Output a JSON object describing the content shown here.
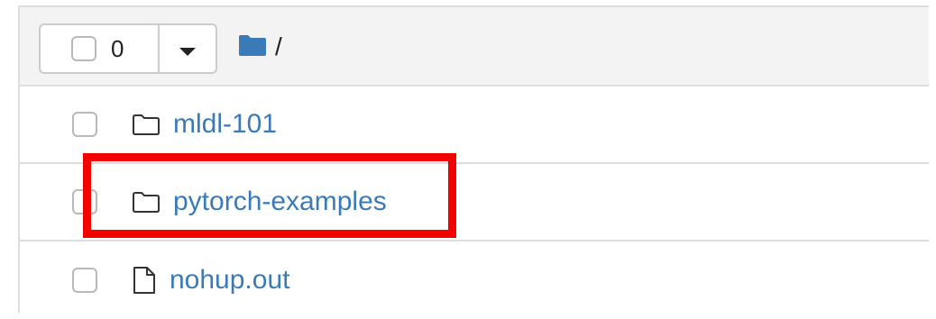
{
  "toolbar": {
    "selected_count": "0",
    "breadcrumb_separator": "/",
    "home_icon": "folder-icon",
    "dropdown_icon": "caret-down-icon"
  },
  "files": [
    {
      "name": "mldl-101",
      "type": "folder",
      "icon": "folder-outline-icon"
    },
    {
      "name": "pytorch-examples",
      "type": "folder",
      "icon": "folder-outline-icon"
    },
    {
      "name": "nohup.out",
      "type": "file",
      "icon": "file-outline-icon"
    }
  ],
  "colors": {
    "link": "#3b7ab8",
    "home_folder": "#3b7ab8",
    "highlight": "#f20000",
    "toolbar_bg": "#f3f3f3",
    "border": "#dddddd"
  }
}
